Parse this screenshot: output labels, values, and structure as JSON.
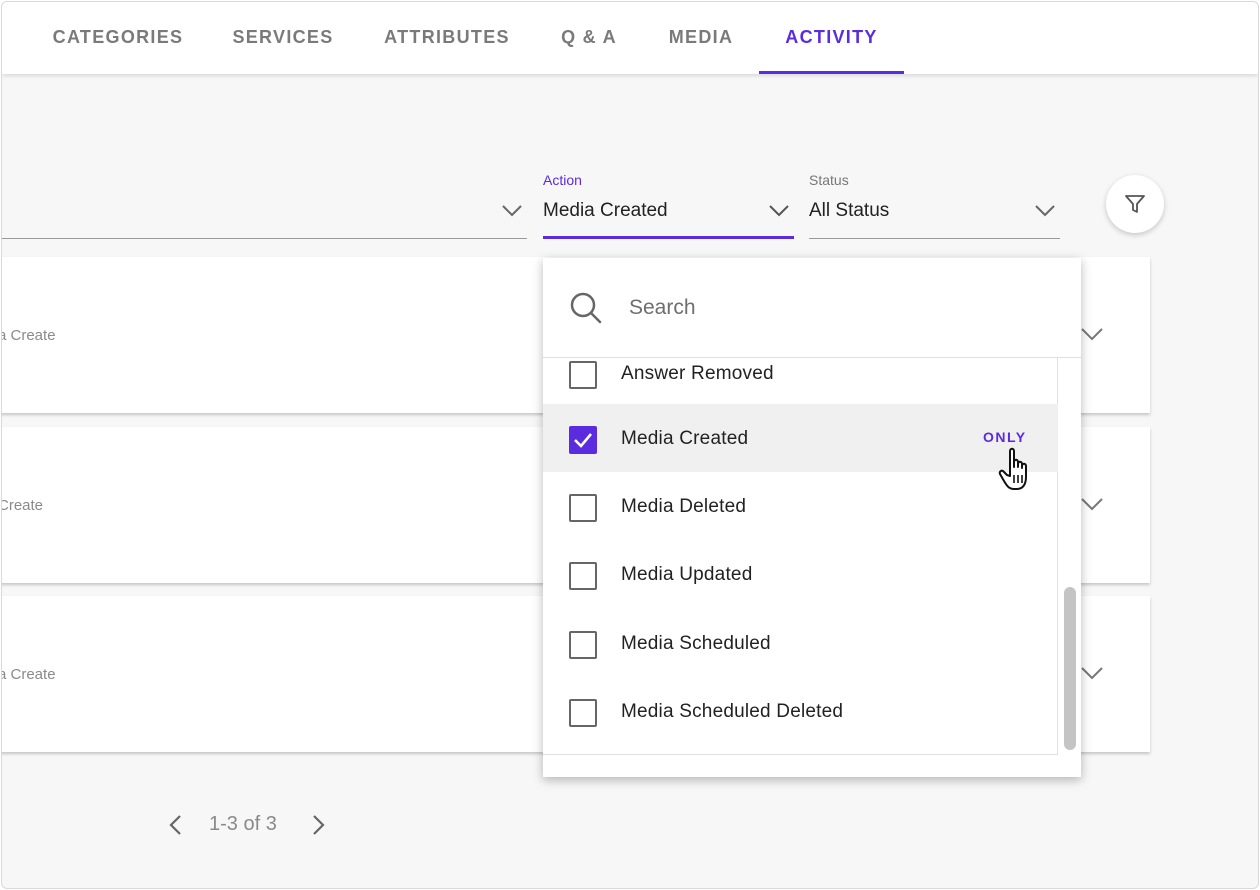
{
  "tabs": [
    {
      "label": "CATEGORIES",
      "active": false
    },
    {
      "label": "SERVICES",
      "active": false
    },
    {
      "label": "ATTRIBUTES",
      "active": false
    },
    {
      "label": "Q & A",
      "active": false
    },
    {
      "label": "MEDIA",
      "active": false
    },
    {
      "label": "ACTIVITY",
      "active": true
    }
  ],
  "filters": {
    "action": {
      "label": "Action",
      "value": "Media Created"
    },
    "status": {
      "label": "Status",
      "value": "All Status"
    }
  },
  "cards": [
    {
      "text": "a Create"
    },
    {
      "text": "Create"
    },
    {
      "text": "a Create"
    }
  ],
  "pagination": {
    "text": "1-3 of 3"
  },
  "dropdown": {
    "search_placeholder": "Search",
    "items": [
      {
        "label": "Answer Removed",
        "checked": false
      },
      {
        "label": "Media Created",
        "checked": true,
        "only_label": "ONLY"
      },
      {
        "label": "Media Deleted",
        "checked": false
      },
      {
        "label": "Media Updated",
        "checked": false
      },
      {
        "label": "Media Scheduled",
        "checked": false
      },
      {
        "label": "Media Scheduled Deleted",
        "checked": false
      }
    ]
  },
  "colors": {
    "accent": "#5b2be0",
    "text": "#222222",
    "muted": "#8a8a8a",
    "background": "#f7f7f7"
  },
  "icons": [
    "chevron-down-icon",
    "filter-icon",
    "search-icon",
    "check-icon",
    "chevron-left-icon",
    "chevron-right-icon",
    "hand-pointer-icon"
  ]
}
